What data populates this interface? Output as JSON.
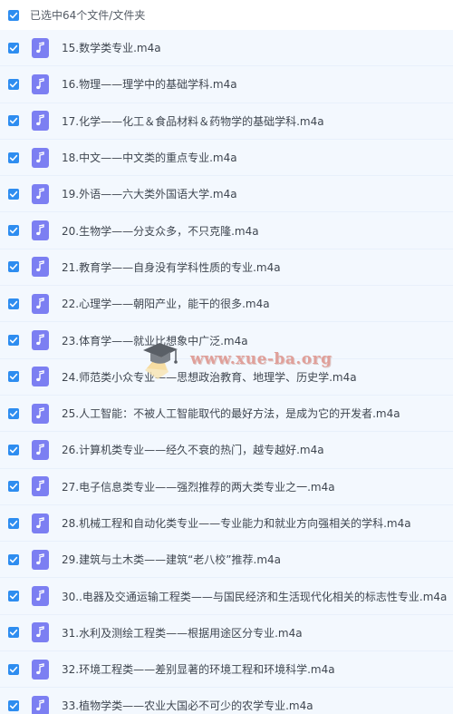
{
  "header": {
    "label": "已选中64个文件/文件夹"
  },
  "files": [
    {
      "name": "15.数学类专业.m4a"
    },
    {
      "name": "16.物理——理学中的基础学科.m4a"
    },
    {
      "name": "17.化学——化工＆食品材料＆药物学的基础学科.m4a"
    },
    {
      "name": "18.中文——中文类的重点专业.m4a"
    },
    {
      "name": "19.外语——六大类外国语大学.m4a"
    },
    {
      "name": "20.生物学——分支众多，不只克隆.m4a"
    },
    {
      "name": "21.教育学——自身没有学科性质的专业.m4a"
    },
    {
      "name": "22.心理学——朝阳产业，能干的很多.m4a"
    },
    {
      "name": "23.体育学——就业比想象中广泛.m4a"
    },
    {
      "name": "24.师范类小众专业——思想政治教育、地理学、历史学.m4a"
    },
    {
      "name": "25.人工智能：不被人工智能取代的最好方法，是成为它的开发者.m4a"
    },
    {
      "name": "26.计算机类专业——经久不衰的热门，越专越好.m4a"
    },
    {
      "name": "27.电子信息类专业——强烈推荐的两大类专业之一.m4a"
    },
    {
      "name": "28.机械工程和自动化类专业——专业能力和就业方向强相关的学科.m4a"
    },
    {
      "name": "29.建筑与土木类——建筑“老八校”推荐.m4a"
    },
    {
      "name": "30..电器及交通运输工程类——与国民经济和生活现代化相关的标志性专业.m4a"
    },
    {
      "name": "31.水利及测绘工程类——根据用途区分专业.m4a"
    },
    {
      "name": "32.环境工程类——差别显著的环境工程和环境科学.m4a"
    },
    {
      "name": "33.植物学类——农业大国必不可少的农学专业.m4a"
    }
  ],
  "watermark": {
    "text": "www.xue-ba.org"
  },
  "colors": {
    "checkbox": "#2e8df0",
    "file_icon": "#7c7ff2",
    "row_bg": "#f3f8fe"
  },
  "icons": {
    "checkbox": "checkmark-icon",
    "file": "audio-file-icon"
  }
}
